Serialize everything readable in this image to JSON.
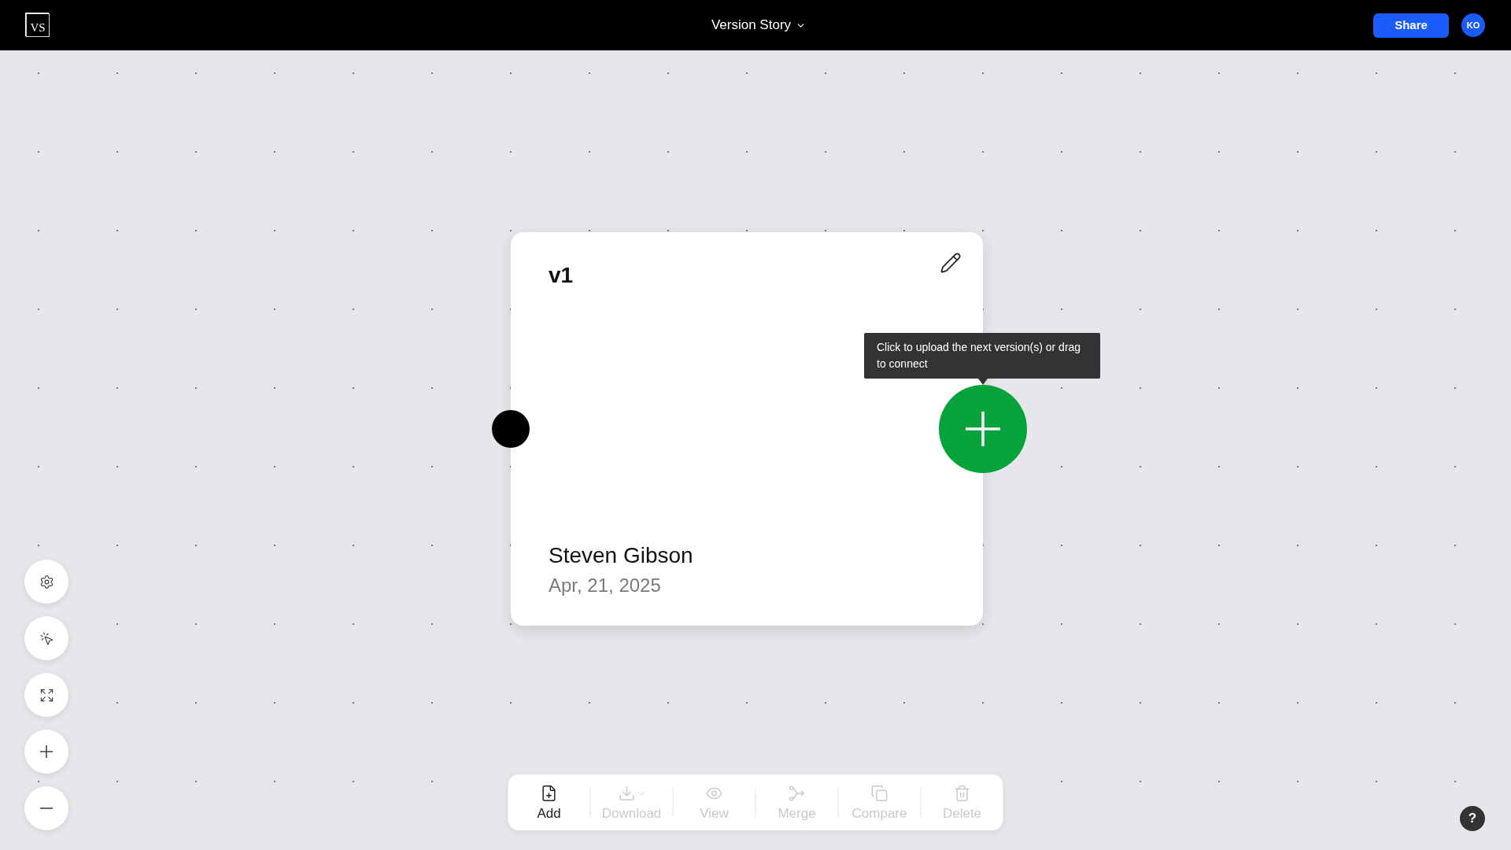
{
  "header": {
    "logo": "VS",
    "title": "Version Story",
    "share_button": "Share",
    "avatar": "KO"
  },
  "node": {
    "title": "v1",
    "author": "Steven Gibson",
    "date": "Apr, 21, 2025"
  },
  "tooltip": "Click to upload the next version(s) or drag to connect",
  "toolbar": [
    {
      "label": "Add",
      "disabled": false
    },
    {
      "label": "Download",
      "disabled": true
    },
    {
      "label": "View",
      "disabled": true
    },
    {
      "label": "Merge",
      "disabled": true
    },
    {
      "label": "Compare",
      "disabled": true
    },
    {
      "label": "Delete",
      "disabled": true
    }
  ],
  "help_button": "?"
}
